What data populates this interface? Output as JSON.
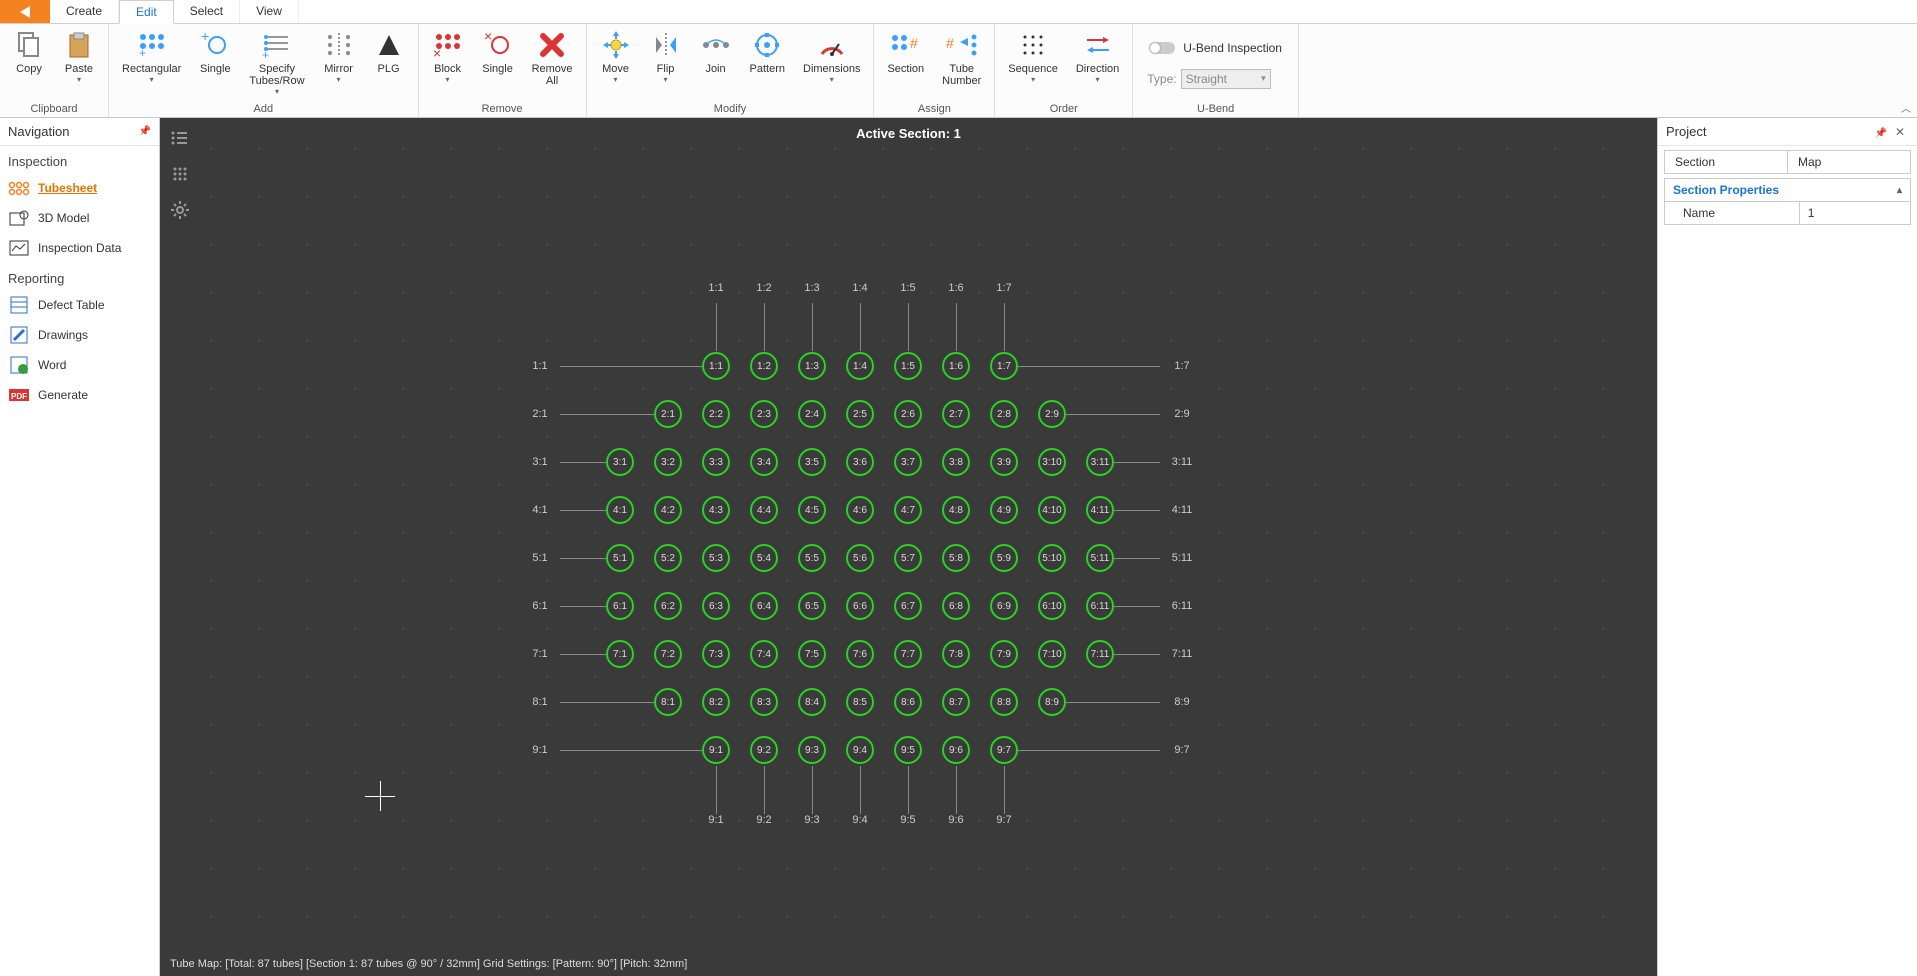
{
  "tabs": {
    "create": "Create",
    "edit": "Edit",
    "select": "Select",
    "view": "View",
    "active": "Edit"
  },
  "ribbon": {
    "clipboard": {
      "label": "Clipboard",
      "copy": "Copy",
      "paste": "Paste"
    },
    "add": {
      "label": "Add",
      "rectangular": "Rectangular",
      "single": "Single",
      "specify": "Specify\nTubes/Row",
      "mirror": "Mirror",
      "plg": "PLG"
    },
    "remove": {
      "label": "Remove",
      "block": "Block",
      "single": "Single",
      "all": "Remove\nAll"
    },
    "modify": {
      "label": "Modify",
      "move": "Move",
      "flip": "Flip",
      "join": "Join",
      "pattern": "Pattern",
      "dimensions": "Dimensions"
    },
    "assign": {
      "label": "Assign",
      "section": "Section",
      "tube_number": "Tube\nNumber"
    },
    "order": {
      "label": "Order",
      "sequence": "Sequence",
      "direction": "Direction"
    },
    "ubend": {
      "label": "U-Bend",
      "inspection": "U-Bend Inspection",
      "type": "Type:",
      "type_value": "Straight"
    }
  },
  "nav": {
    "title": "Navigation",
    "inspection_title": "Inspection",
    "reporting_title": "Reporting",
    "tubesheet": "Tubesheet",
    "model3d": "3D Model",
    "inspection_data": "Inspection Data",
    "defect_table": "Defect Table",
    "drawings": "Drawings",
    "word": "Word",
    "generate": "Generate"
  },
  "canvas": {
    "title": "Active Section: 1",
    "status": "Tube Map: [Total: 87 tubes] [Section 1: 87 tubes @ 90° / 32mm] Grid Settings: [Pattern: 90°] [Pitch: 32mm]",
    "top_cols": [
      "1:1",
      "1:2",
      "1:3",
      "1:4",
      "1:5",
      "1:6",
      "1:7"
    ],
    "bottom_cols": [
      "9:1",
      "9:2",
      "9:3",
      "9:4",
      "9:5",
      "9:6",
      "9:7"
    ],
    "rows": [
      {
        "left": "1:1",
        "right": "1:7",
        "start": 3,
        "count": 7,
        "t": 1
      },
      {
        "left": "2:1",
        "right": "2:9",
        "start": 2,
        "count": 9,
        "t": 2
      },
      {
        "left": "3:1",
        "right": "3:11",
        "start": 1,
        "count": 11,
        "t": 3
      },
      {
        "left": "4:1",
        "right": "4:11",
        "start": 1,
        "count": 11,
        "t": 4
      },
      {
        "left": "5:1",
        "right": "5:11",
        "start": 1,
        "count": 11,
        "t": 5
      },
      {
        "left": "6:1",
        "right": "6:11",
        "start": 1,
        "count": 11,
        "t": 6
      },
      {
        "left": "7:1",
        "right": "7:11",
        "start": 1,
        "count": 11,
        "t": 7
      },
      {
        "left": "8:1",
        "right": "8:9",
        "start": 2,
        "count": 9,
        "t": 8
      },
      {
        "left": "9:1",
        "right": "9:7",
        "start": 3,
        "count": 7,
        "t": 9
      }
    ]
  },
  "project": {
    "title": "Project",
    "tab_section": "Section",
    "tab_map": "Map",
    "props_title": "Section Properties",
    "prop_name_label": "Name",
    "prop_name_value": "1"
  }
}
